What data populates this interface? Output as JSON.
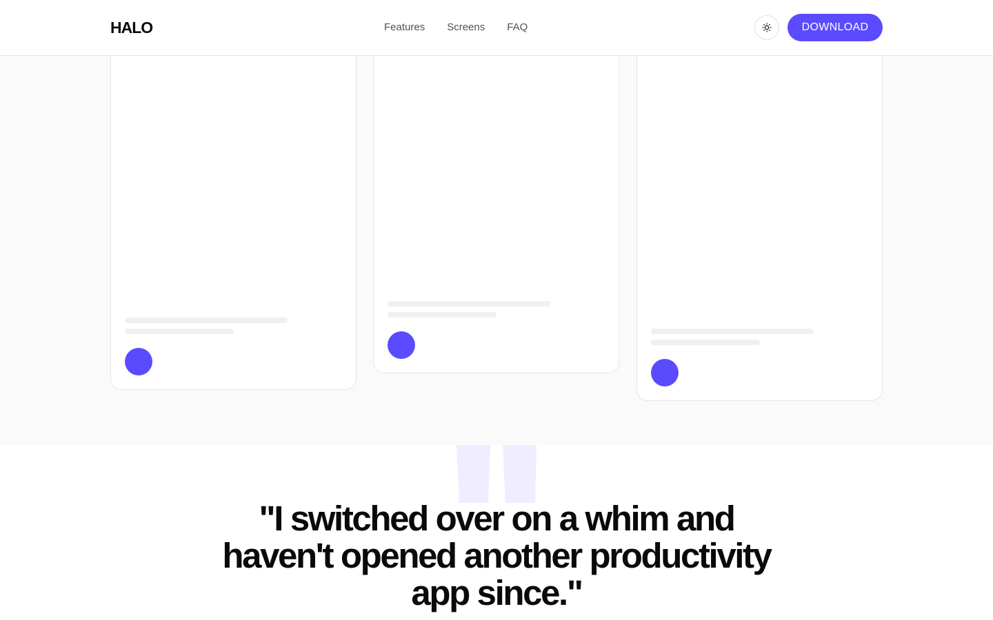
{
  "header": {
    "logo": "HALO",
    "nav": [
      "Features",
      "Screens",
      "FAQ"
    ],
    "download_label": "DOWNLOAD",
    "theme_icon": "sun-icon"
  },
  "screens": {
    "cards": [
      {
        "lines": 2,
        "accent": "#5b4bff"
      },
      {
        "lines": 2,
        "accent": "#5b4bff"
      },
      {
        "lines": 2,
        "accent": "#5b4bff"
      }
    ]
  },
  "testimonial": {
    "quote": "\"I switched over on a whim and haven't opened another productivity app since.\"",
    "quote_icon": "quote-mark-icon"
  },
  "colors": {
    "accent": "#5b4bff",
    "section_bg": "#fafafa",
    "quote_mark": "#efedff"
  }
}
